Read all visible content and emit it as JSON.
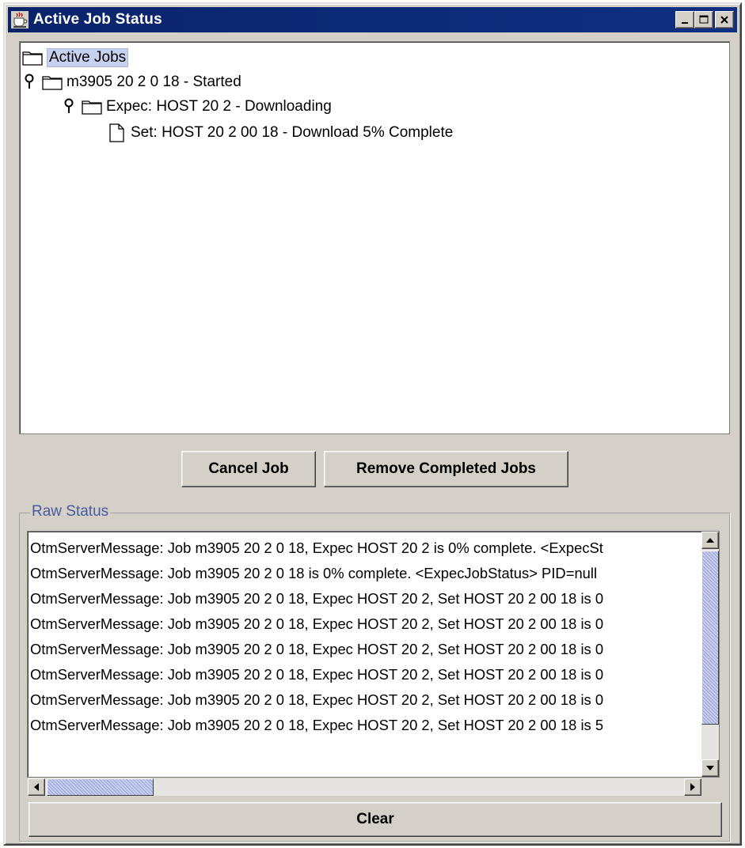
{
  "window": {
    "title": "Active Job Status",
    "controls": [
      "minimize-icon",
      "maximize-icon",
      "close-icon"
    ]
  },
  "tree": {
    "root": {
      "label": "Active Jobs",
      "icon": "folder-icon",
      "selected": true
    },
    "job": {
      "label": "m3905 20 2 0 18 - Started",
      "icon": "folder-icon",
      "expanded": true
    },
    "expec": {
      "label": "Expec: HOST 20 2 - Downloading",
      "icon": "folder-icon",
      "expanded": true
    },
    "set": {
      "label": "Set: HOST 20 2 00 18 - Download 5% Complete",
      "icon": "document-icon"
    }
  },
  "buttons": {
    "cancel": "Cancel Job",
    "remove": "Remove Completed Jobs",
    "clear": "Clear"
  },
  "raw_status": {
    "title": "Raw Status",
    "lines": [
      "OtmServerMessage: Job m3905 20 2 0 18, Expec HOST 20 2 is 0% complete. <ExpecSt",
      "OtmServerMessage: Job m3905 20 2 0 18 is 0% complete. <ExpecJobStatus> PID=null",
      "OtmServerMessage: Job m3905 20 2 0 18, Expec HOST 20 2, Set HOST 20 2 00 18 is 0",
      "OtmServerMessage: Job m3905 20 2 0 18, Expec HOST 20 2, Set HOST 20 2 00 18 is 0",
      "OtmServerMessage: Job m3905 20 2 0 18, Expec HOST 20 2, Set HOST 20 2 00 18 is 0",
      "OtmServerMessage: Job m3905 20 2 0 18, Expec HOST 20 2, Set HOST 20 2 00 18 is 0",
      "OtmServerMessage: Job m3905 20 2 0 18, Expec HOST 20 2, Set HOST 20 2 00 18 is 0",
      "OtmServerMessage: Job m3905 20 2 0 18, Expec HOST 20 2, Set HOST 20 2 00 18 is 5"
    ]
  },
  "colors": {
    "titlebar": "#0a246a",
    "window_bg": "#d4d0c8",
    "selection": "#c8d0f0",
    "group_title": "#4a5aa0"
  }
}
